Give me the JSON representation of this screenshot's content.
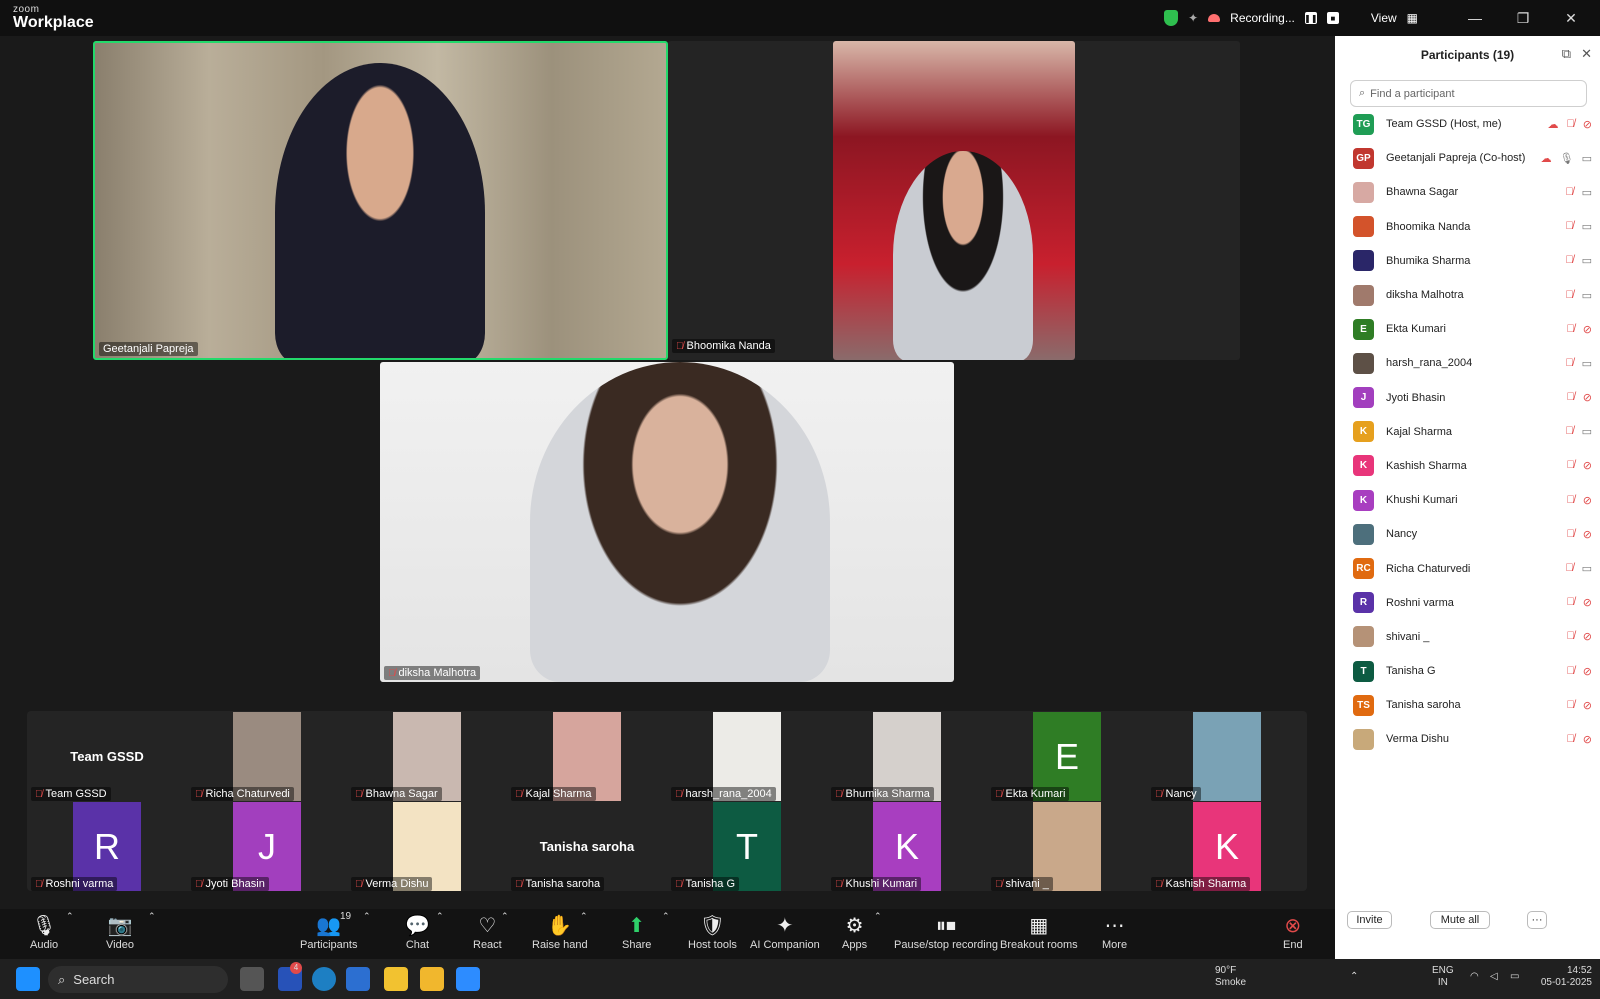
{
  "app": {
    "brand_top": "zoom",
    "brand_bottom": "Workplace"
  },
  "topbar": {
    "recording_label": "Recording...",
    "view_label": "View"
  },
  "video": {
    "speaker_name": "Geetanjali Papreja",
    "second_name": "Bhoomika Nanda",
    "third_name": "diksha Malhotra"
  },
  "strip": [
    {
      "name": "Team GSSD",
      "tile_text": "Team GSSD",
      "color": ""
    },
    {
      "name": "Richa Chaturvedi",
      "tile_text": "",
      "color": "#9a8b80"
    },
    {
      "name": "Bhawna Sagar",
      "tile_text": "",
      "color": "#c9b8b0"
    },
    {
      "name": "Kajal Sharma",
      "tile_text": "",
      "color": "#d6a59d"
    },
    {
      "name": "harsh_rana_2004",
      "tile_text": "",
      "color": "#ecebe7"
    },
    {
      "name": "Bhumika Sharma",
      "tile_text": "",
      "color": "#d5d0cc"
    },
    {
      "name": "Ekta Kumari",
      "tile_text": "E",
      "color": "#2f7d25"
    },
    {
      "name": "Nancy",
      "tile_text": "",
      "color": "#7aa2b5"
    },
    {
      "name": "Roshni varma",
      "tile_text": "R",
      "color": "#5a32a8"
    },
    {
      "name": "Jyoti Bhasin",
      "tile_text": "J",
      "color": "#a23fbe"
    },
    {
      "name": "Verma Dishu",
      "tile_text": "",
      "color": "#f3e3c3"
    },
    {
      "name": "Tanisha saroha",
      "tile_text": "Tanisha saroha",
      "color": ""
    },
    {
      "name": "Tanisha G",
      "tile_text": "T",
      "color": "#0d5b42"
    },
    {
      "name": "Khushi Kumari",
      "tile_text": "K",
      "color": "#a83ec0"
    },
    {
      "name": "shivani _",
      "tile_text": "",
      "color": "#c9a88a"
    },
    {
      "name": "Kashish Sharma",
      "tile_text": "K",
      "color": "#e8357a"
    }
  ],
  "panel": {
    "title": "Participants (19)",
    "search_placeholder": "Find a participant",
    "participants": [
      {
        "name": "Team GSSD (Host, me)",
        "initials": "TG",
        "color": "#1f9d55",
        "mic": "muted",
        "cam": "off"
      },
      {
        "name": "Geetanjali Papreja (Co-host)",
        "initials": "GP",
        "color": "#c1372f",
        "mic": "on",
        "cam": "on"
      },
      {
        "name": "Bhawna Sagar",
        "initials": "",
        "color": "#d7a9a3",
        "mic": "muted",
        "cam": "on"
      },
      {
        "name": "Bhoomika Nanda",
        "initials": "",
        "color": "#d3532b",
        "mic": "muted",
        "cam": "on"
      },
      {
        "name": "Bhumika Sharma",
        "initials": "",
        "color": "#2a2668",
        "mic": "muted",
        "cam": "on"
      },
      {
        "name": "diksha Malhotra",
        "initials": "",
        "color": "#a07a6c",
        "mic": "muted",
        "cam": "on"
      },
      {
        "name": "Ekta Kumari",
        "initials": "E",
        "color": "#2f7d25",
        "mic": "muted",
        "cam": "off"
      },
      {
        "name": "harsh_rana_2004",
        "initials": "",
        "color": "#5d5046",
        "mic": "muted",
        "cam": "on"
      },
      {
        "name": "Jyoti Bhasin",
        "initials": "J",
        "color": "#a23fbe",
        "mic": "muted",
        "cam": "off"
      },
      {
        "name": "Kajal Sharma",
        "initials": "K",
        "color": "#e6a01e",
        "mic": "muted",
        "cam": "on"
      },
      {
        "name": "Kashish Sharma",
        "initials": "K",
        "color": "#e8357a",
        "mic": "muted",
        "cam": "off"
      },
      {
        "name": "Khushi Kumari",
        "initials": "K",
        "color": "#a83ec0",
        "mic": "muted",
        "cam": "off"
      },
      {
        "name": "Nancy",
        "initials": "",
        "color": "#4d6f7c",
        "mic": "muted",
        "cam": "off"
      },
      {
        "name": "Richa Chaturvedi",
        "initials": "RC",
        "color": "#e06a10",
        "mic": "muted",
        "cam": "on"
      },
      {
        "name": "Roshni varma",
        "initials": "R",
        "color": "#5a32a8",
        "mic": "muted",
        "cam": "off"
      },
      {
        "name": "shivani _",
        "initials": "",
        "color": "#b59277",
        "mic": "muted",
        "cam": "off"
      },
      {
        "name": "Tanisha G",
        "initials": "T",
        "color": "#0d5b42",
        "mic": "muted",
        "cam": "off"
      },
      {
        "name": "Tanisha saroha",
        "initials": "TS",
        "color": "#e06a10",
        "mic": "muted",
        "cam": "off"
      },
      {
        "name": "Verma Dishu",
        "initials": "",
        "color": "#c8a97a",
        "mic": "muted",
        "cam": "off"
      }
    ],
    "invite_label": "Invite",
    "mute_all_label": "Mute all",
    "more_label": "···"
  },
  "toolbar": {
    "audio": "Audio",
    "video": "Video",
    "participants": "Participants",
    "participants_count": "19",
    "chat": "Chat",
    "react": "React",
    "raise_hand": "Raise hand",
    "share": "Share",
    "host_tools": "Host tools",
    "ai_companion": "AI Companion",
    "apps": "Apps",
    "pause_recording": "Pause/stop recording",
    "breakout": "Breakout rooms",
    "more": "More",
    "end": "End"
  },
  "taskbar": {
    "search_label": "Search",
    "weather_temp": "90°F",
    "weather_desc": "Smoke",
    "lang_top": "ENG",
    "lang_bottom": "IN",
    "time": "14:52",
    "date": "05-01-2025",
    "mail_badge": "4"
  }
}
